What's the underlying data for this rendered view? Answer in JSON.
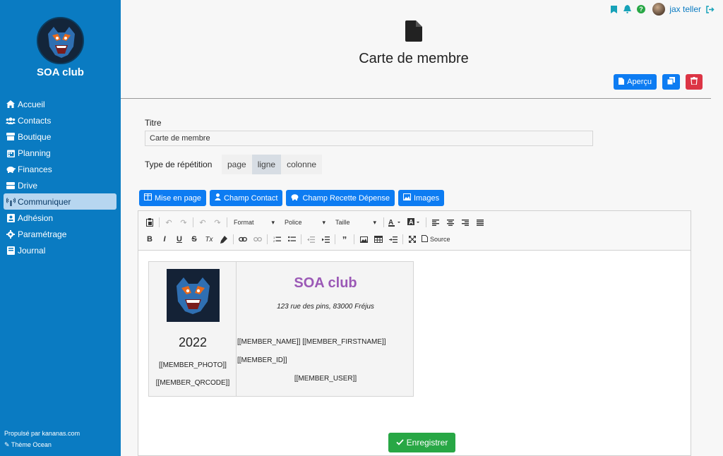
{
  "sidebar": {
    "club_name": "SOA club",
    "items": [
      {
        "label": "Accueil",
        "icon": "home-icon"
      },
      {
        "label": "Contacts",
        "icon": "users-icon"
      },
      {
        "label": "Boutique",
        "icon": "store-icon"
      },
      {
        "label": "Planning",
        "icon": "calendar-icon"
      },
      {
        "label": "Finances",
        "icon": "piggy-bank-icon"
      },
      {
        "label": "Drive",
        "icon": "drive-icon"
      },
      {
        "label": "Communiquer",
        "icon": "broadcast-icon",
        "active": true
      },
      {
        "label": "Adhésion",
        "icon": "id-card-icon"
      },
      {
        "label": "Paramétrage",
        "icon": "gear-icon"
      },
      {
        "label": "Journal",
        "icon": "book-icon"
      }
    ],
    "footer_powered": "Propulsé par kananas.com",
    "footer_theme": "Thème Ocean"
  },
  "topbar": {
    "username": "jax teller",
    "help": "?"
  },
  "page": {
    "title": "Carte de membre"
  },
  "actions": {
    "preview_label": "Aperçu"
  },
  "form": {
    "title_label": "Titre",
    "title_value": "Carte de membre",
    "repetition_label": "Type de répétition",
    "repetition_options": [
      "page",
      "ligne",
      "colonne"
    ],
    "repetition_selected": "ligne"
  },
  "insert_buttons": {
    "layout": "Mise en page",
    "contact_field": "Champ Contact",
    "income_expense_field": "Champ Recette Dépense",
    "images": "Images"
  },
  "toolbar": {
    "format": "Format",
    "font": "Police",
    "size": "Taille",
    "source": "Source",
    "bold": "B",
    "italic": "I",
    "underline": "U",
    "strike": "S",
    "clear": "Tx"
  },
  "card": {
    "year": "2022",
    "member_photo": "[[MEMBER_PHOTO]]",
    "member_qrcode": "[[MEMBER_QRCODE]]",
    "club_title": "SOA club",
    "address": "123 rue des pins, 83000 Fréjus",
    "member_names": "[[MEMBER_NAME]] [[MEMBER_FIRSTNAME]]",
    "member_id": "[[MEMBER_ID]]",
    "member_user": "[[MEMBER_USER]]"
  },
  "save_label": "Enregistrer",
  "colors": {
    "sidebar": "#0a7bc2",
    "primary": "#0d7cf2",
    "danger": "#dc3545",
    "success": "#28a745",
    "card_title": "#9b59b6"
  }
}
